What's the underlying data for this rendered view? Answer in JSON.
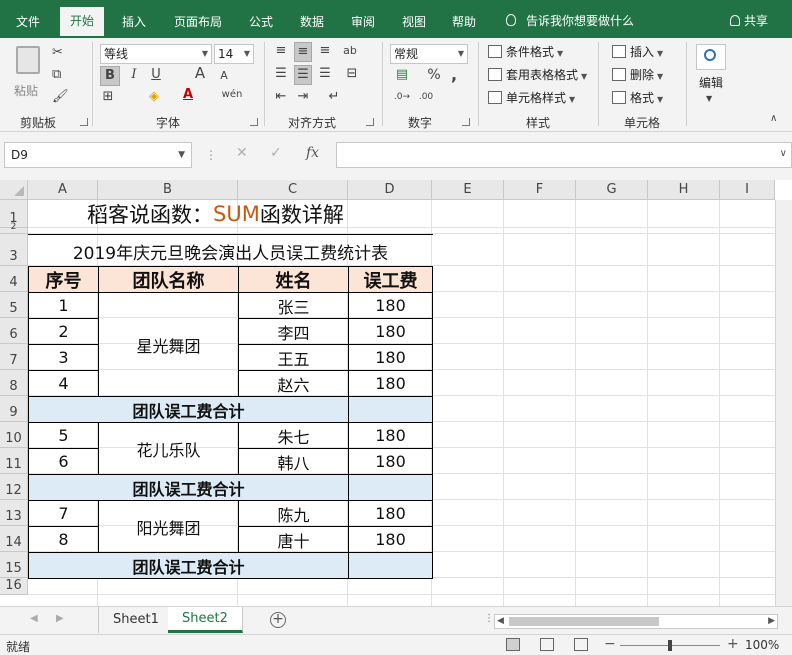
{
  "ribbon_tabs": [
    "文件",
    "开始",
    "插入",
    "页面布局",
    "公式",
    "数据",
    "审阅",
    "视图",
    "帮助"
  ],
  "active_tab": "开始",
  "tell_me": "告诉我你想要做什么",
  "share": "共享",
  "clipboard": {
    "paste": "粘贴",
    "label": "剪贴板"
  },
  "font": {
    "name": "等线",
    "size": "14",
    "bold": "B",
    "italic": "I",
    "underline": "U",
    "grow": "A",
    "shrink": "A",
    "wen": "wén",
    "fill_letter": "A",
    "label": "字体"
  },
  "alignment": {
    "label": "对齐方式"
  },
  "number": {
    "format": "常规",
    "percent": "%",
    "comma": ",",
    "label": "数字"
  },
  "styles": {
    "conditional": "条件格式",
    "table": "套用表格格式",
    "cell": "单元格样式",
    "label": "样式"
  },
  "cells": {
    "insert": "插入",
    "delete": "删除",
    "format": "格式",
    "label": "单元格"
  },
  "editing": {
    "label": "编辑"
  },
  "name_box": "D9",
  "formula_buttons": {
    "cancel": "✕",
    "enter": "✓",
    "fx": "fx"
  },
  "columns": [
    "A",
    "B",
    "C",
    "D",
    "E",
    "F",
    "G",
    "H",
    "I"
  ],
  "rows": [
    "1",
    "2",
    "3",
    "4",
    "5",
    "6",
    "7",
    "8",
    "9",
    "10",
    "11",
    "12",
    "13",
    "14",
    "15",
    "16"
  ],
  "sheet": {
    "title_prefix": "稻客说函数：",
    "title_sum": "SUM",
    "title_suffix": "函数详解",
    "table_title": "2019年庆元旦晚会演出人员误工费统计表",
    "headers": [
      "序号",
      "团队名称",
      "姓名",
      "误工费"
    ],
    "groups": [
      {
        "team": "星光舞团",
        "members": [
          {
            "no": "1",
            "name": "张三",
            "fee": "180"
          },
          {
            "no": "2",
            "name": "李四",
            "fee": "180"
          },
          {
            "no": "3",
            "name": "王五",
            "fee": "180"
          },
          {
            "no": "4",
            "name": "赵六",
            "fee": "180"
          }
        ]
      },
      {
        "team": "花儿乐队",
        "members": [
          {
            "no": "5",
            "name": "朱七",
            "fee": "180"
          },
          {
            "no": "6",
            "name": "韩八",
            "fee": "180"
          }
        ]
      },
      {
        "team": "阳光舞团",
        "members": [
          {
            "no": "7",
            "name": "陈九",
            "fee": "180"
          },
          {
            "no": "8",
            "name": "唐十",
            "fee": "180"
          }
        ]
      }
    ],
    "subtotal_label": "团队误工费合计"
  },
  "sheet_tabs": [
    "Sheet1",
    "Sheet2"
  ],
  "active_sheet": "Sheet2",
  "status": "就绪",
  "zoom": "100%"
}
